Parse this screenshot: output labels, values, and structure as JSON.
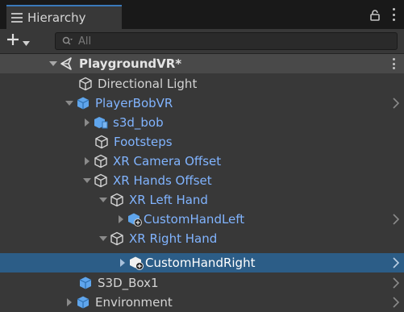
{
  "panel": {
    "tab_title": "Hierarchy",
    "tab_icon": "hamburger-menu-icon",
    "actions": [
      "lock-icon",
      "kebab-menu-icon"
    ]
  },
  "toolbar": {
    "add_label": "+",
    "search_placeholder": "All"
  },
  "colors": {
    "prefab": "#81b4ff",
    "selection": "#2c5d87",
    "background": "#383838"
  },
  "tree": {
    "scene": "PlaygroundVR*",
    "items": [
      {
        "label": "Directional Light",
        "icon": "gameobject-icon",
        "style": "white",
        "expanded": null
      },
      {
        "label": "PlayerBobVR",
        "icon": "prefab-icon",
        "style": "blue",
        "expanded": true
      },
      {
        "label": "s3d_bob",
        "icon": "model-prefab-icon",
        "style": "blue",
        "expanded": false
      },
      {
        "label": "Footsteps",
        "icon": "gameobject-icon",
        "style": "blue",
        "expanded": null
      },
      {
        "label": "XR Camera Offset",
        "icon": "gameobject-icon",
        "style": "blue",
        "expanded": false
      },
      {
        "label": "XR Hands Offset",
        "icon": "gameobject-icon",
        "style": "blue",
        "expanded": true
      },
      {
        "label": "XR Left Hand",
        "icon": "gameobject-icon",
        "style": "blue",
        "expanded": true
      },
      {
        "label": "CustomHandLeft",
        "icon": "prefab-added-icon",
        "style": "blue",
        "expanded": false
      },
      {
        "label": "XR Right Hand",
        "icon": "gameobject-icon",
        "style": "blue",
        "expanded": true
      },
      {
        "label": "CustomHandRight",
        "icon": "prefab-added-icon",
        "style": "white",
        "expanded": false,
        "selected": true
      },
      {
        "label": "S3D_Box1",
        "icon": "prefab-icon",
        "style": "white",
        "expanded": null
      },
      {
        "label": "Environment",
        "icon": "prefab-icon",
        "style": "white",
        "expanded": false
      }
    ]
  }
}
